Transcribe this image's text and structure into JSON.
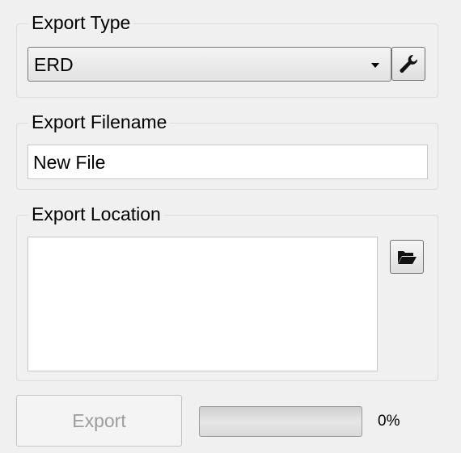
{
  "export_type": {
    "label": "Export Type",
    "selected": "ERD",
    "settings_icon": "wrench-icon"
  },
  "export_filename": {
    "label": "Export Filename",
    "value": "New File"
  },
  "export_location": {
    "label": "Export Location",
    "value": "",
    "browse_icon": "folder-open-icon"
  },
  "actions": {
    "export_label": "Export"
  },
  "progress": {
    "percent": 0,
    "text": "0%"
  }
}
